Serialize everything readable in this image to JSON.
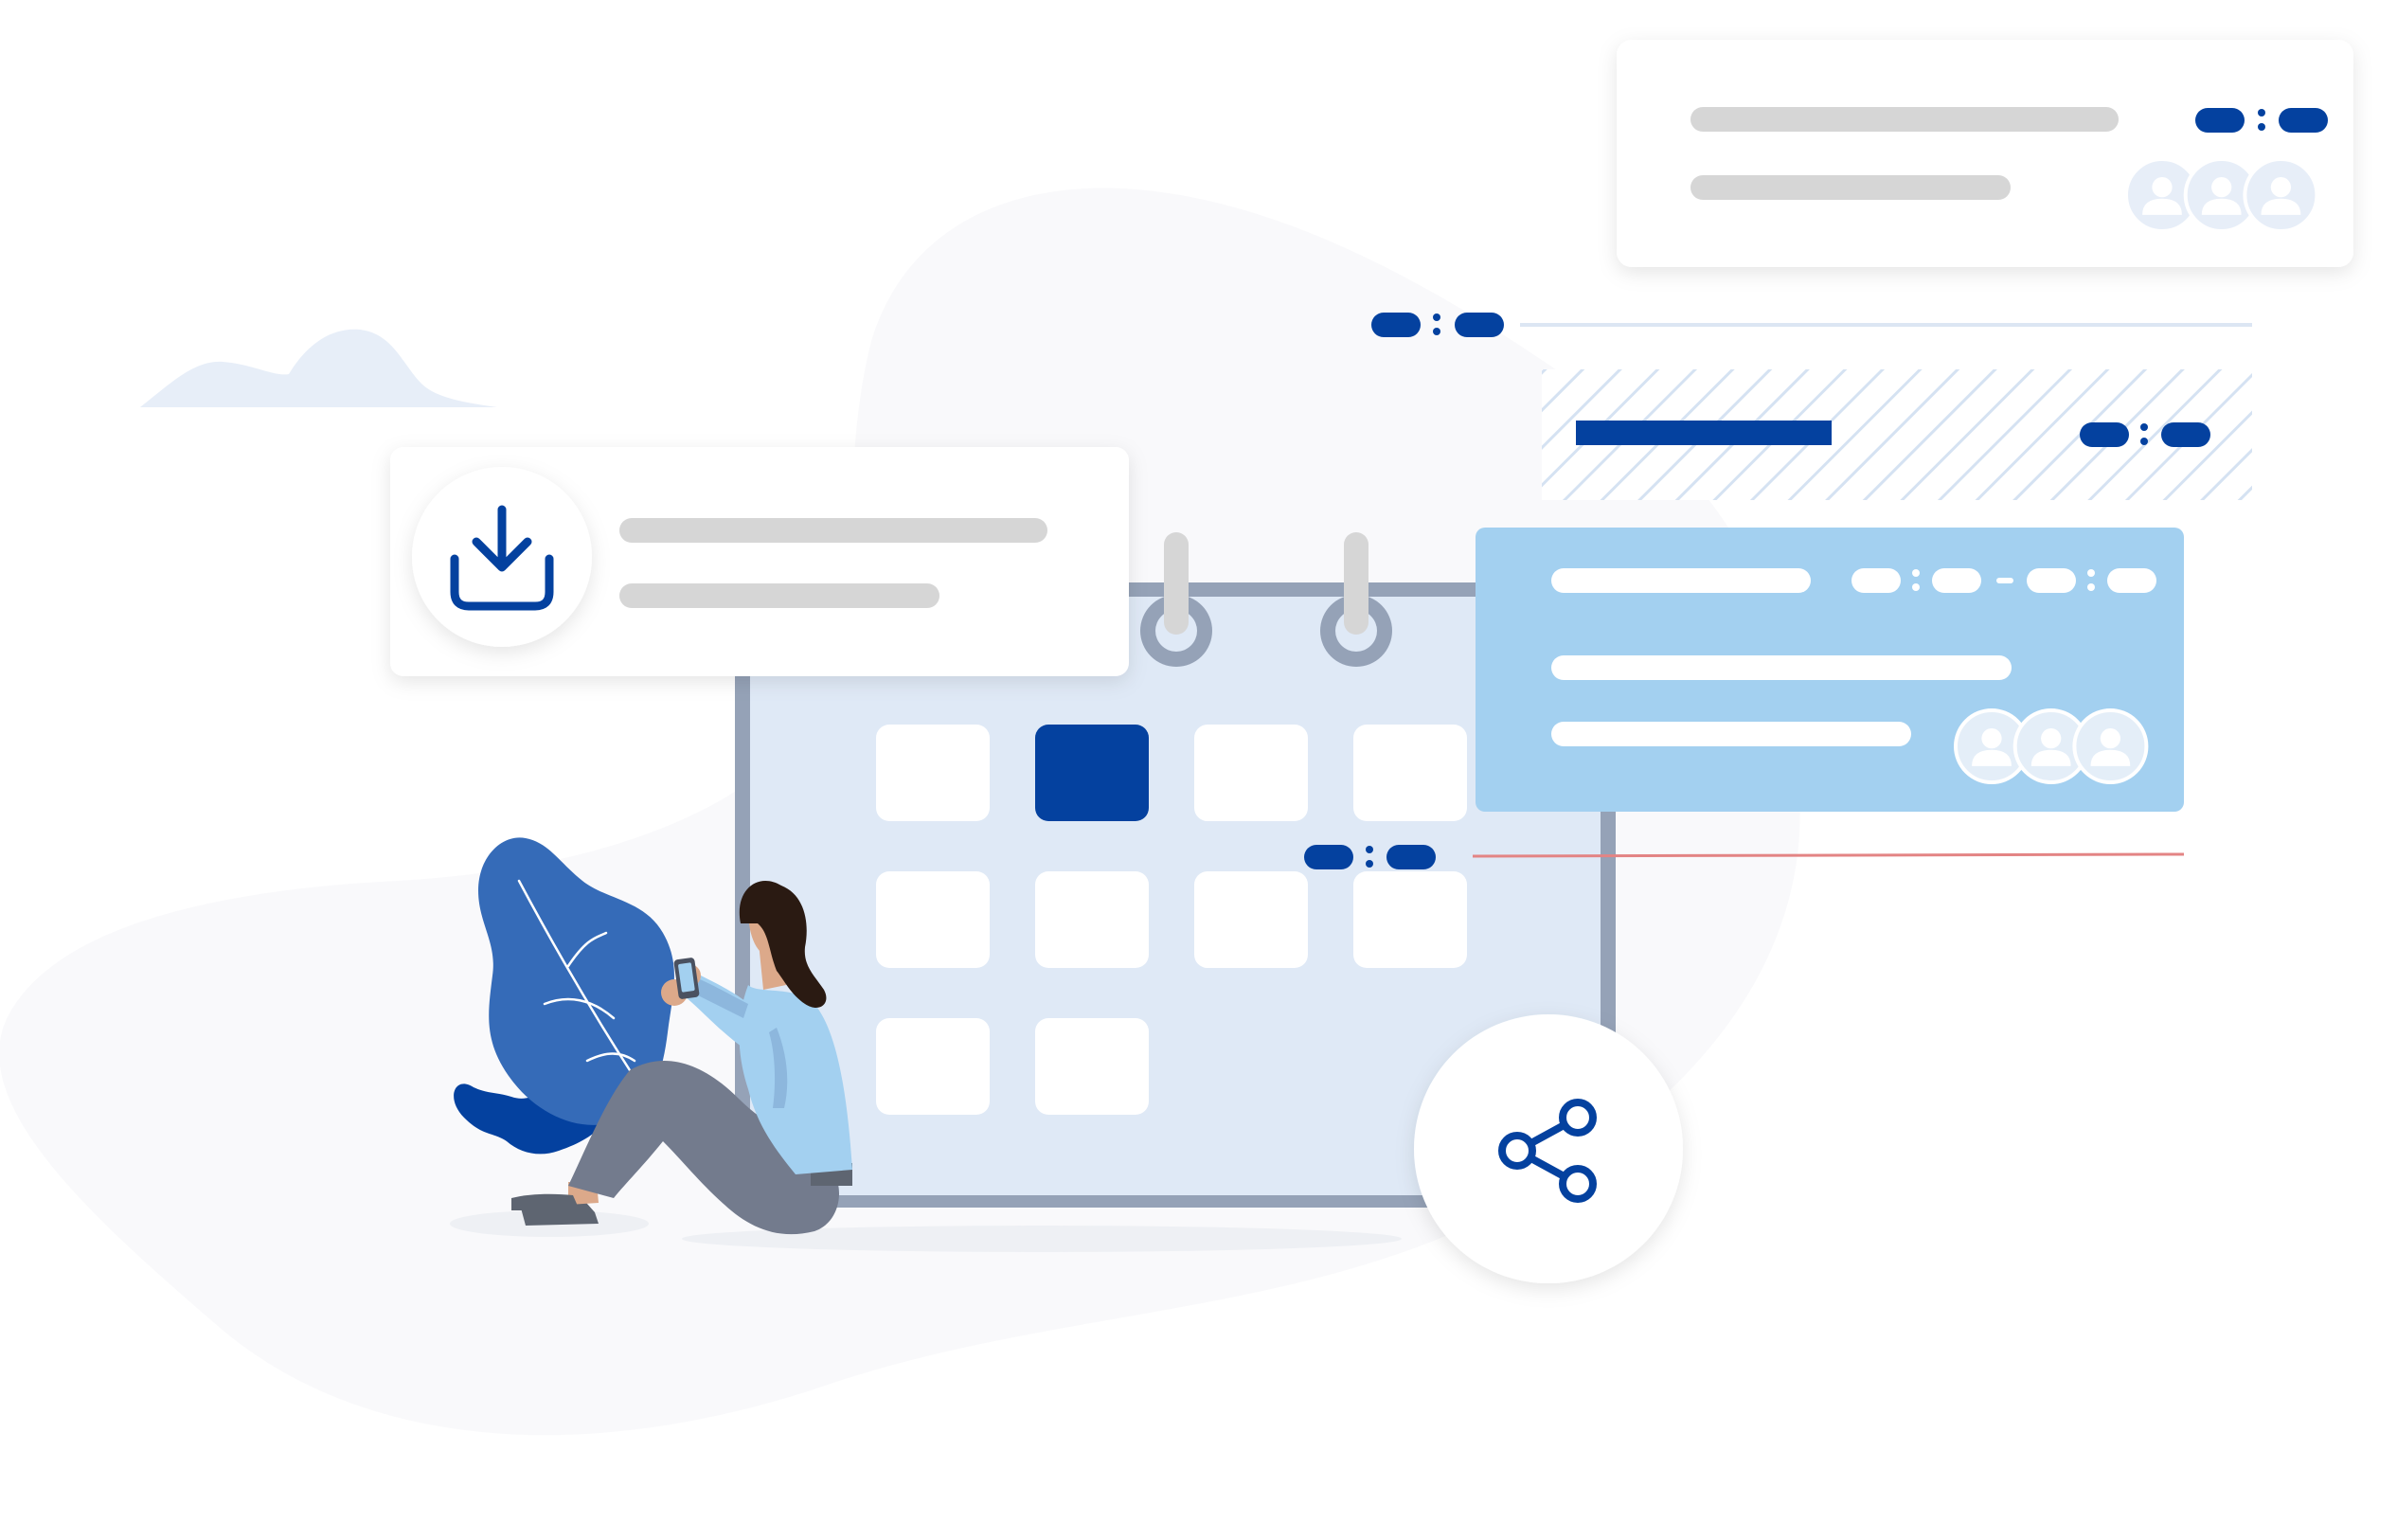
{
  "illustration": {
    "colors": {
      "primary_blue": "#04419F",
      "light_blue_card": "#A3D0F0",
      "calendar_bg": "#DFE9F6",
      "calendar_frame": "#95A2B7",
      "placeholder_gray": "#D6D6D6",
      "blob_bg": "#F9F9FB",
      "red_line": "#E38484",
      "leaf_blue": "#356BB8"
    },
    "icons": [
      "download-icon",
      "share-icon",
      "avatar-icon"
    ],
    "calendar": {
      "highlighted_cell_index": 1,
      "row_cell_counts": [
        4,
        4,
        2
      ]
    },
    "avatar_group_size": 3
  }
}
